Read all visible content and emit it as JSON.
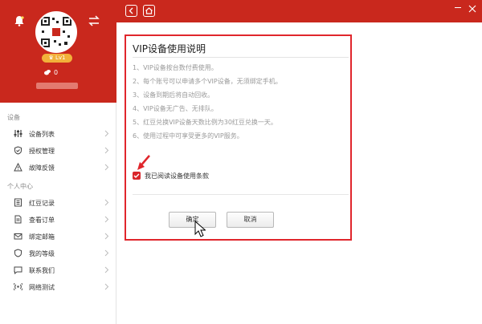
{
  "sidebar": {
    "level": "Lv1",
    "coins": "0",
    "sections": [
      "设备",
      "个人中心"
    ],
    "items": [
      {
        "label": "设备列表",
        "icon": "sliders-icon"
      },
      {
        "label": "授权管理",
        "icon": "shield-check-icon"
      },
      {
        "label": "故障反馈",
        "icon": "warning-icon"
      },
      {
        "label": "红豆记录",
        "icon": "list-icon"
      },
      {
        "label": "查看订单",
        "icon": "document-icon"
      },
      {
        "label": "绑定邮箱",
        "icon": "mail-icon"
      },
      {
        "label": "我的等级",
        "icon": "shield-icon"
      },
      {
        "label": "联系我们",
        "icon": "chat-icon"
      },
      {
        "label": "网络测试",
        "icon": "signal-icon"
      }
    ]
  },
  "topbar": {
    "back_icon": "chevron-left-icon",
    "home_icon": "home-icon"
  },
  "dialog": {
    "title": "VIP设备使用说明",
    "rules": [
      "1、VIP设备按台数付费使用。",
      "2、每个账号可以申请多个VIP设备，无须绑定手机。",
      "3、设备到期后将自动回收。",
      "4、VIP设备无广告、无排队。",
      "5、红豆兑换VIP设备天数比例为30红豆兑换一天。",
      "6、使用过程中可享受更多的VIP服务。"
    ],
    "agree_label": "我已阅读设备使用条款",
    "agree_checked": true,
    "confirm_label": "确定",
    "cancel_label": "取消"
  },
  "colors": {
    "brand_red": "#c9281d",
    "highlight_red": "#e0262c",
    "level_badge": "#f2b13a"
  }
}
